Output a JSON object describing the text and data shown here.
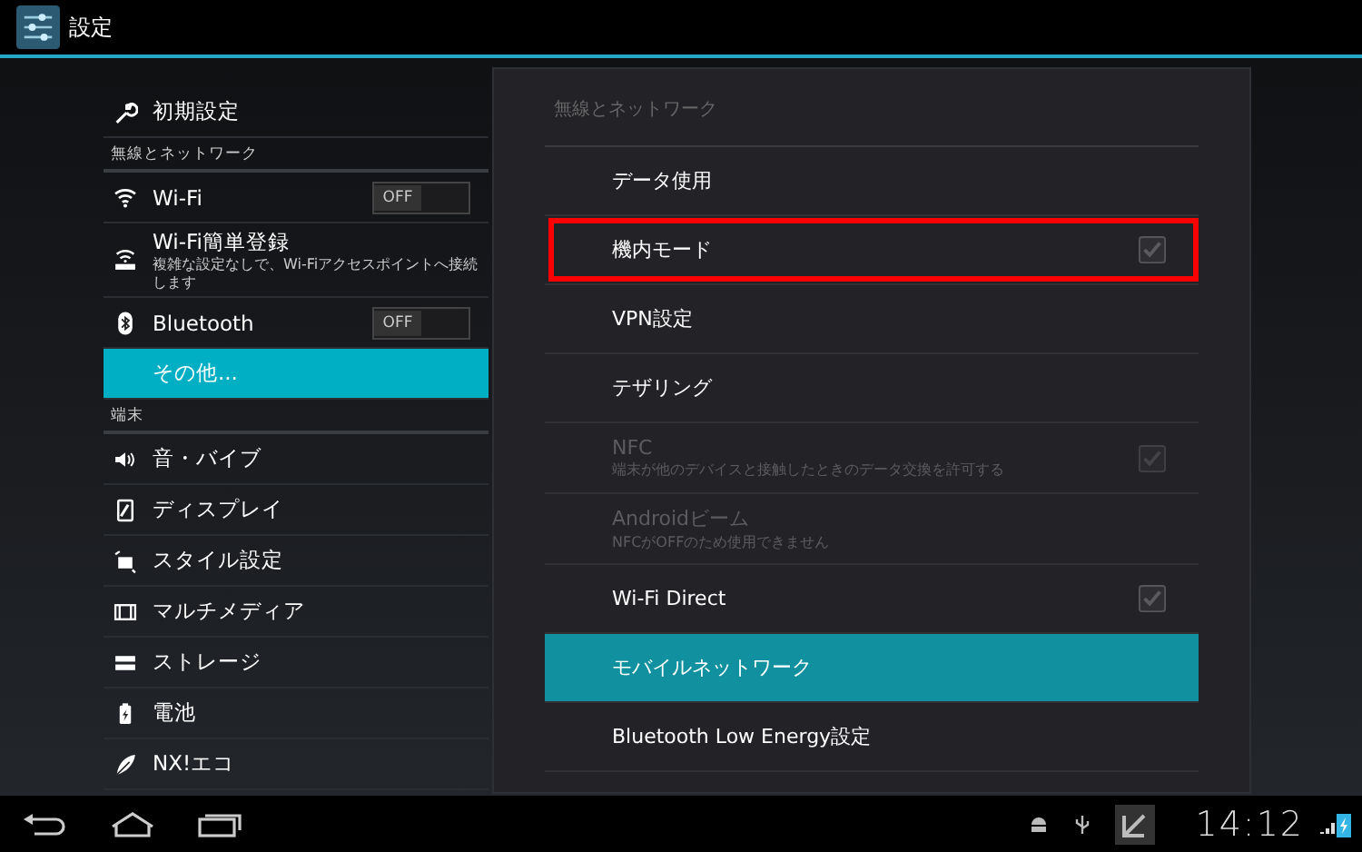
{
  "title_bar": {
    "title": "設定"
  },
  "sidebar": {
    "top_item": {
      "label": "初期設定",
      "selected": false
    },
    "sections": [
      {
        "header": "無線とネットワーク",
        "items": [
          {
            "label": "Wi-Fi",
            "selected": false,
            "toggle": {
              "label": "OFF",
              "on": false
            }
          },
          {
            "label": "Wi-Fi簡単登録",
            "sublabel": "複雑な設定なしで、Wi-Fiアクセスポイントへ接続します",
            "selected": false
          },
          {
            "label": "Bluetooth",
            "selected": false,
            "toggle": {
              "label": "OFF",
              "on": false
            }
          },
          {
            "label": "その他...",
            "selected": true
          }
        ]
      },
      {
        "header": "端末",
        "items": [
          {
            "label": "音・バイブ",
            "selected": false
          },
          {
            "label": "ディスプレイ",
            "selected": false
          },
          {
            "label": "スタイル設定",
            "selected": false
          },
          {
            "label": "マルチメディア",
            "selected": false
          },
          {
            "label": "ストレージ",
            "selected": false
          },
          {
            "label": "電池",
            "selected": false
          },
          {
            "label": "NX!エコ",
            "selected": false
          }
        ]
      }
    ]
  },
  "panel": {
    "header": "無線とネットワーク",
    "items": [
      {
        "label": "データ使用",
        "kind": "plain",
        "selected": false,
        "disabled": false,
        "highlighted": false
      },
      {
        "label": "機内モード",
        "kind": "checkbox",
        "checked": false,
        "selected": false,
        "disabled": false,
        "highlighted": true
      },
      {
        "label": "VPN設定",
        "kind": "plain",
        "selected": false,
        "disabled": false,
        "highlighted": false
      },
      {
        "label": "テザリング",
        "kind": "plain",
        "selected": false,
        "disabled": false,
        "highlighted": false
      },
      {
        "label": "NFC",
        "sublabel": "端末が他のデバイスと接触したときのデータ交換を許可する",
        "kind": "checkbox",
        "checked": false,
        "selected": false,
        "disabled": true,
        "highlighted": false
      },
      {
        "label": "Androidビーム",
        "sublabel": "NFCがOFFのため使用できません",
        "kind": "plain",
        "selected": false,
        "disabled": true,
        "highlighted": false
      },
      {
        "label": "Wi-Fi Direct",
        "kind": "checkbox",
        "checked": false,
        "selected": false,
        "disabled": false,
        "highlighted": false
      },
      {
        "label": "モバイルネットワーク",
        "kind": "plain",
        "selected": true,
        "disabled": false,
        "highlighted": false
      },
      {
        "label": "Bluetooth Low Energy設定",
        "kind": "plain",
        "selected": false,
        "disabled": false,
        "highlighted": false
      }
    ]
  },
  "system_bar": {
    "time": "14:12"
  }
}
